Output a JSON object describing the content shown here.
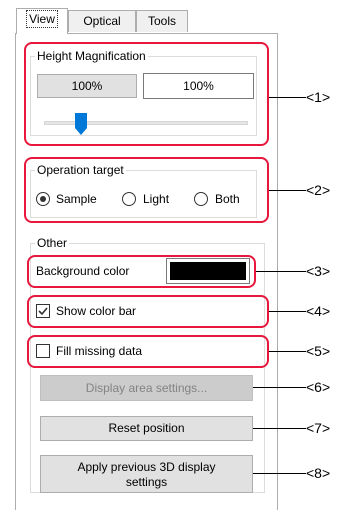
{
  "tabs": [
    {
      "label": "View",
      "active": true
    },
    {
      "label": "Optical",
      "active": false
    },
    {
      "label": "Tools",
      "active": false
    }
  ],
  "height_magnification": {
    "title": "Height Magnification",
    "button_label": "100%",
    "field_value": "100%",
    "slider_fraction": 0.18
  },
  "operation_target": {
    "title": "Operation target",
    "options": [
      {
        "label": "Sample",
        "selected": true
      },
      {
        "label": "Light",
        "selected": false
      },
      {
        "label": "Both",
        "selected": false
      }
    ]
  },
  "other": {
    "title": "Other",
    "background_color_label": "Background color",
    "background_color_value": "#000000",
    "show_color_bar_label": "Show color bar",
    "show_color_bar_checked": true,
    "fill_missing_label": "Fill missing data",
    "fill_missing_checked": false
  },
  "buttons": {
    "display_area": "Display area settings...",
    "reset_position": "Reset position",
    "apply_previous_line1": "Apply previous 3D display",
    "apply_previous_line2": "settings"
  },
  "callouts": [
    "<1>",
    "<2>",
    "<3>",
    "<4>",
    "<5>",
    "<6>",
    "<7>",
    "<8>"
  ],
  "accent_color": "#e8173c"
}
